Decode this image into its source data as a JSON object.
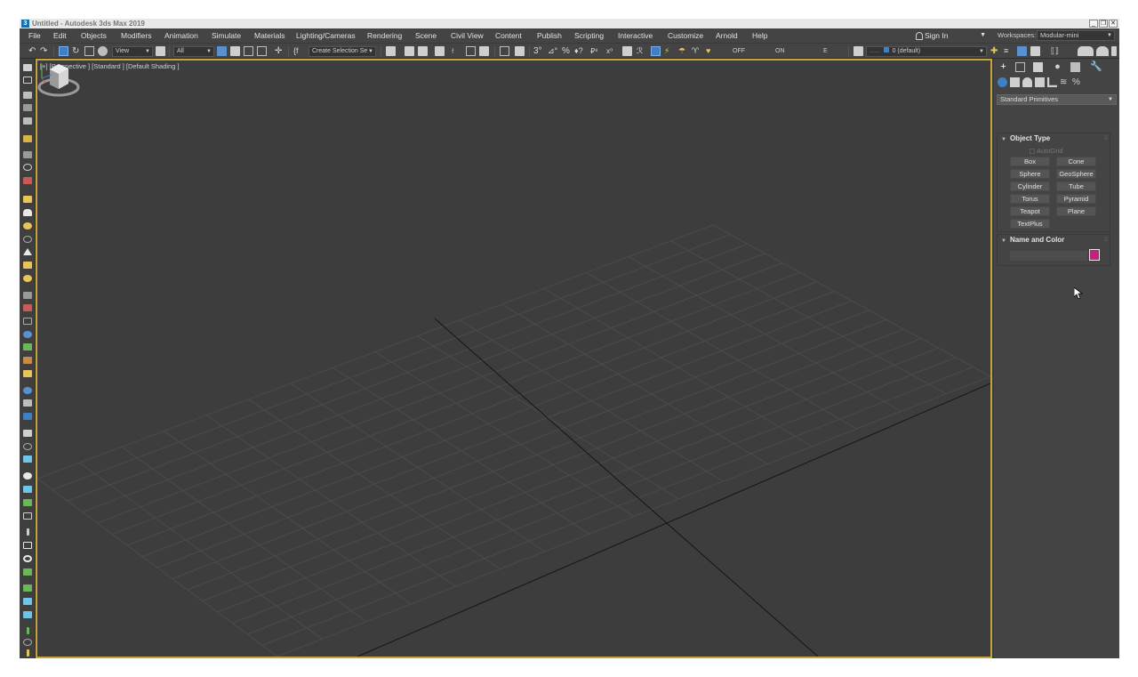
{
  "window": {
    "title": "Untitled - Autodesk 3ds Max 2019",
    "app_icon": "3",
    "controls": [
      "_",
      "❐",
      "✕"
    ]
  },
  "menu": {
    "items": [
      "File",
      "Edit",
      "Objects",
      "Modifiers",
      "Animation",
      "Simulate",
      "Materials",
      "Lighting/Cameras",
      "Rendering",
      "Scene",
      "Civil View",
      "Content",
      "Publish",
      "Scripting",
      "Interactive",
      "Customize",
      "Arnold",
      "Help"
    ],
    "sign_in": "Sign In",
    "workspaces_label": "Workspaces:",
    "workspace_value": "Modular-mini"
  },
  "toolbar": {
    "ref_coord": "View",
    "selection_filter": "All",
    "create_selection_set": "Create Selection Se",
    "snap_off": "OFF",
    "snap_on": "ON",
    "e_label": "E",
    "layer": "0 (default)"
  },
  "viewport": {
    "label": "[+] [Perspective ] [Standard ] [Default Shading ]",
    "border_color": "#c8a33a"
  },
  "command_panel": {
    "category": "Standard Primitives",
    "object_type": {
      "title": "Object Type",
      "autogrid": "AutoGrid",
      "buttons": [
        "Box",
        "Cone",
        "Sphere",
        "GeoSphere",
        "Cylinder",
        "Tube",
        "Torus",
        "Pyramid",
        "Teapot",
        "Plane",
        "TextPlus"
      ]
    },
    "name_and_color": {
      "title": "Name and Color",
      "name_value": "",
      "color": "#c0237a"
    }
  },
  "icons": {
    "cmd_tabs": [
      "create-icon",
      "modify-icon",
      "hierarchy-icon",
      "motion-icon",
      "display-icon",
      "utilities-icon"
    ],
    "sub_tabs": [
      "geometry-icon",
      "shapes-icon",
      "lights-icon",
      "cameras-icon",
      "helpers-icon",
      "spacewarps-icon",
      "systems-icon"
    ]
  }
}
